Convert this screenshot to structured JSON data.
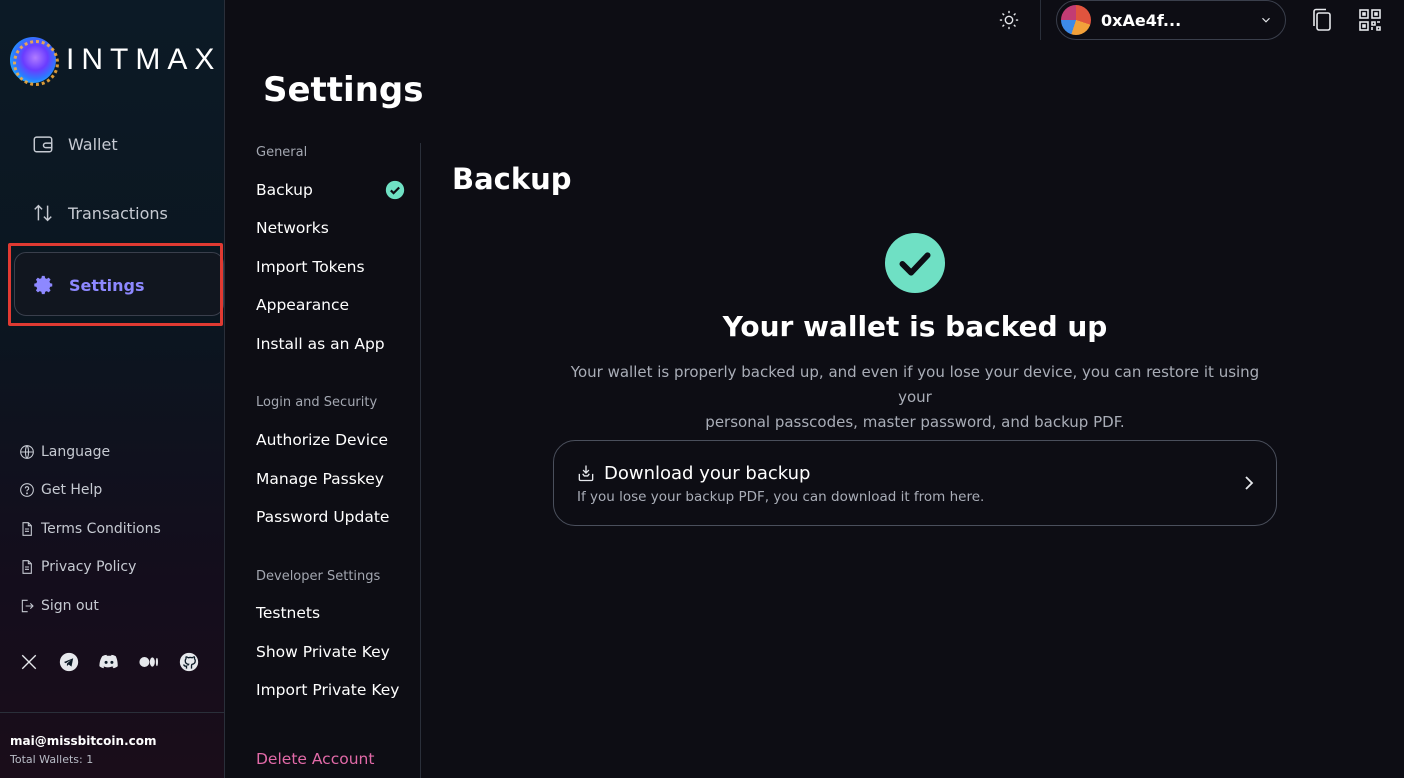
{
  "brand": {
    "name": "INTMAX"
  },
  "sidebar": {
    "nav": [
      {
        "label": "Wallet",
        "icon": "wallet-icon"
      },
      {
        "label": "Transactions",
        "icon": "transfer-arrows-icon"
      },
      {
        "label": "Settings",
        "icon": "gear-icon",
        "active": true
      }
    ],
    "links": [
      {
        "label": "Language",
        "icon": "globe-icon"
      },
      {
        "label": "Get Help",
        "icon": "help-icon"
      },
      {
        "label": "Terms Conditions",
        "icon": "document-icon"
      },
      {
        "label": "Privacy Policy",
        "icon": "document-icon"
      },
      {
        "label": "Sign out",
        "icon": "sign-out-icon"
      }
    ],
    "socials": [
      "x-icon",
      "telegram-icon",
      "discord-icon",
      "medium-icon",
      "github-icon"
    ],
    "user": {
      "email": "mai@missbitcoin.com",
      "wallets": "Total Wallets: 1"
    }
  },
  "topbar": {
    "account": "0xAe4f..."
  },
  "settings": {
    "title": "Settings",
    "sections": [
      {
        "label": "General",
        "items": [
          "Backup",
          "Networks",
          "Import Tokens",
          "Appearance",
          "Install as an App"
        ]
      },
      {
        "label": "Login and Security",
        "items": [
          "Authorize Device",
          "Manage Passkey",
          "Password Update"
        ]
      },
      {
        "label": "Developer Settings",
        "items": [
          "Testnets",
          "Show Private Key",
          "Import Private Key"
        ]
      }
    ],
    "danger": "Delete Account"
  },
  "content": {
    "title": "Backup",
    "status_title": "Your wallet is backed up",
    "status_desc_1": "Your wallet is properly backed up, and even if you lose your device, you can restore it using your",
    "status_desc_2": "personal passcodes, master password, and backup PDF.",
    "download": {
      "title": "Download your backup",
      "subtitle": "If you lose your backup PDF, you can download it from here."
    }
  },
  "colors": {
    "accent": "#8d88ff",
    "success": "#6fe0c4",
    "danger": "#e26aa8",
    "highlight": "#e03a32"
  }
}
